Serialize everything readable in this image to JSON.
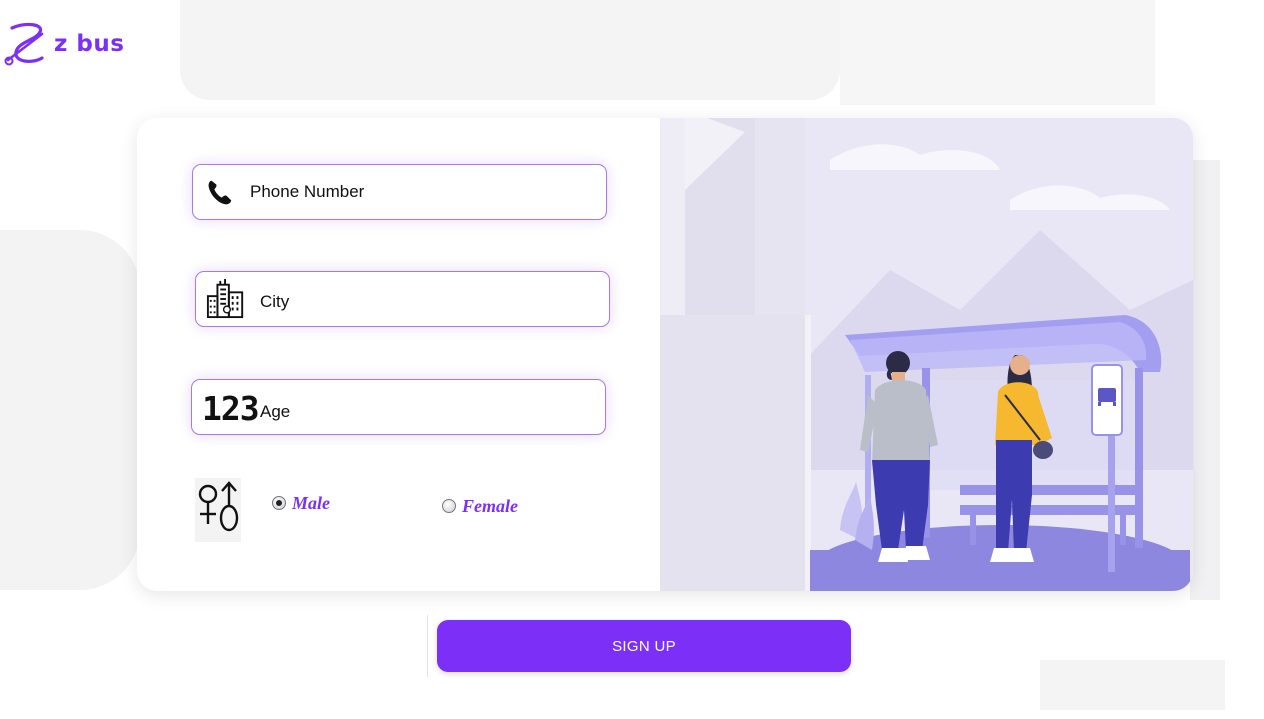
{
  "brand": {
    "name": "z bus",
    "color": "#7b2ff7"
  },
  "form": {
    "phone_placeholder": "Phone Number",
    "city_placeholder": "City",
    "age_placeholder": "Age",
    "age_icon_text": "123",
    "gender": {
      "options": [
        "Male",
        "Female"
      ],
      "selected": "Male"
    },
    "submit_label": "SIGN UP"
  },
  "icons": {
    "phone": "phone-icon",
    "city": "city-buildings-icon",
    "age": "number-123-icon",
    "gender": "gender-symbols-icon",
    "logo": "z-bus-logo-icon"
  },
  "illustration": {
    "subject": "couple-at-bus-stop-illustration"
  }
}
